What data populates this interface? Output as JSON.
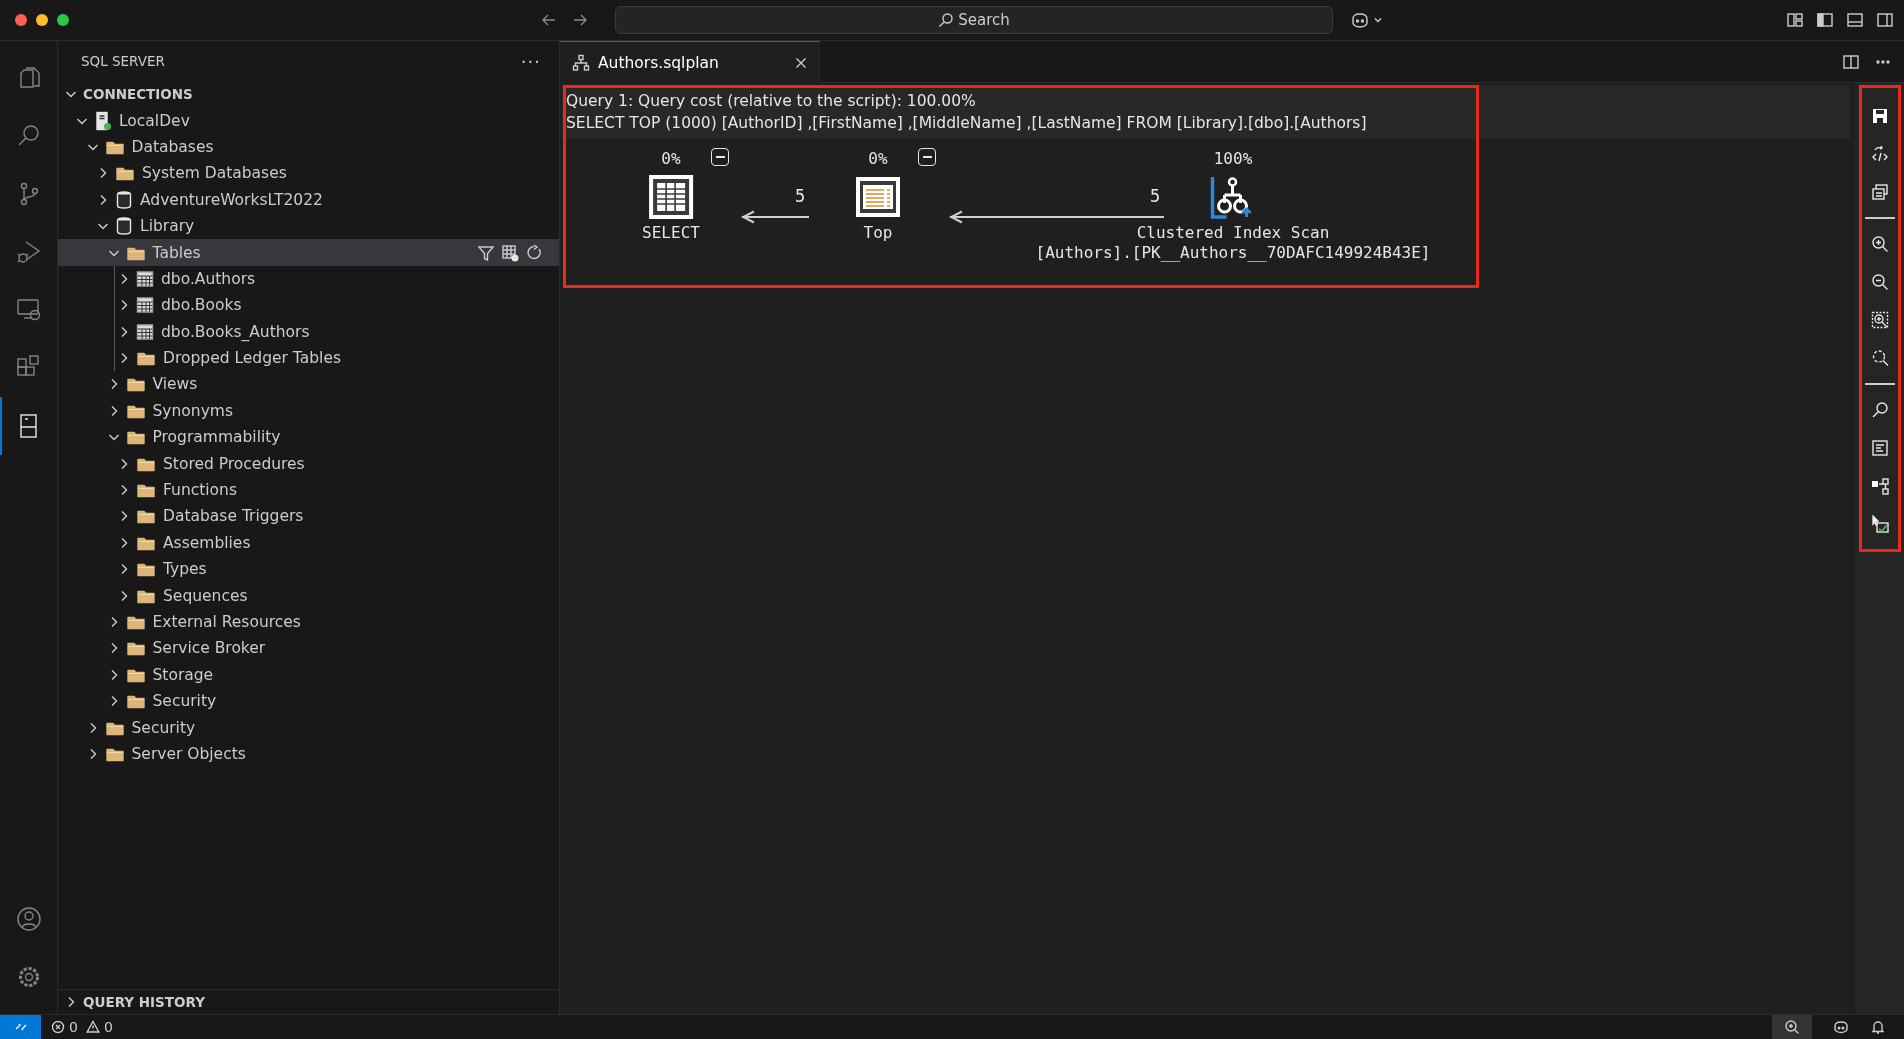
{
  "titlebar": {
    "search": {
      "placeholder": "Search"
    }
  },
  "activity_bar": {
    "top": [
      {
        "kind": "files",
        "selected": false
      },
      {
        "kind": "search",
        "selected": false
      },
      {
        "kind": "branch",
        "selected": false
      },
      {
        "kind": "debug",
        "selected": false
      },
      {
        "kind": "remote",
        "selected": false
      },
      {
        "kind": "extensions",
        "selected": false
      },
      {
        "kind": "server",
        "selected": true
      }
    ],
    "bottom": [
      {
        "kind": "account",
        "selected": false
      },
      {
        "kind": "settings",
        "selected": false
      }
    ]
  },
  "sidebar": {
    "title": "SQL SERVER",
    "more": "···",
    "connections": {
      "title": "CONNECTIONS",
      "expanded": true
    },
    "tree": [
      {
        "label": "LocalDev",
        "kind": "server",
        "connected": true,
        "expanded": true,
        "selected": false,
        "children": [
          {
            "label": "Databases",
            "kind": "folder",
            "expanded": true,
            "selected": false,
            "children": [
              {
                "label": "System Databases",
                "kind": "folder",
                "expanded": false,
                "selected": false
              },
              {
                "label": "AdventureWorksLT2022",
                "kind": "database",
                "expanded": false,
                "selected": false
              },
              {
                "label": "Library",
                "kind": "database",
                "expanded": true,
                "selected": false,
                "children": [
                  {
                    "label": "Tables",
                    "kind": "folder",
                    "expanded": true,
                    "selected": true,
                    "show_actions": true,
                    "children": [
                      {
                        "label": "dbo.Authors",
                        "kind": "table",
                        "expanded": false,
                        "selected": false
                      },
                      {
                        "label": "dbo.Books",
                        "kind": "table",
                        "expanded": false,
                        "selected": false
                      },
                      {
                        "label": "dbo.Books_Authors",
                        "kind": "table",
                        "expanded": false,
                        "selected": false
                      },
                      {
                        "label": "Dropped Ledger Tables",
                        "kind": "folder",
                        "expanded": false,
                        "selected": false
                      }
                    ]
                  },
                  {
                    "label": "Views",
                    "kind": "folder",
                    "expanded": false,
                    "selected": false
                  },
                  {
                    "label": "Synonyms",
                    "kind": "folder",
                    "expanded": false,
                    "selected": false
                  },
                  {
                    "label": "Programmability",
                    "kind": "folder",
                    "expanded": true,
                    "selected": false,
                    "children": [
                      {
                        "label": "Stored Procedures",
                        "kind": "folder",
                        "expanded": false,
                        "selected": false
                      },
                      {
                        "label": "Functions",
                        "kind": "folder",
                        "expanded": false,
                        "selected": false
                      },
                      {
                        "label": "Database Triggers",
                        "kind": "folder",
                        "expanded": false,
                        "selected": false
                      },
                      {
                        "label": "Assemblies",
                        "kind": "folder",
                        "expanded": false,
                        "selected": false
                      },
                      {
                        "label": "Types",
                        "kind": "folder",
                        "expanded": false,
                        "selected": false
                      },
                      {
                        "label": "Sequences",
                        "kind": "folder",
                        "expanded": false,
                        "selected": false
                      }
                    ]
                  },
                  {
                    "label": "External Resources",
                    "kind": "folder",
                    "expanded": false,
                    "selected": false
                  },
                  {
                    "label": "Service Broker",
                    "kind": "folder",
                    "expanded": false,
                    "selected": false
                  },
                  {
                    "label": "Storage",
                    "kind": "folder",
                    "expanded": false,
                    "selected": false
                  },
                  {
                    "label": "Security",
                    "kind": "folder",
                    "expanded": false,
                    "selected": false
                  }
                ]
              }
            ]
          },
          {
            "label": "Security",
            "kind": "folder",
            "expanded": false,
            "selected": false
          },
          {
            "label": "Server Objects",
            "kind": "folder",
            "expanded": false,
            "selected": false
          }
        ]
      }
    ],
    "query_history": {
      "title": "QUERY HISTORY",
      "expanded": false
    }
  },
  "tabs": [
    {
      "label": "Authors.sqlplan",
      "selected": true
    }
  ],
  "plan": {
    "header": [
      "Query 1: Query cost (relative to the script): 100.00%",
      "SELECT TOP (1000) [AuthorID] ,[FirstName] ,[MiddleName] ,[LastName] FROM [Library].[dbo].[Authors]"
    ],
    "nodes": [
      {
        "kind": "select",
        "cost": "0%",
        "label": "SELECT",
        "collapsible": true
      },
      {
        "kind": "top",
        "cost": "0%",
        "label": "Top",
        "collapsible": true
      },
      {
        "kind": "scan",
        "cost": "100%",
        "label": "Clustered Index Scan",
        "detail": "[Authors].[PK__Authors__70DAFC149924B43E]",
        "collapsible": false
      }
    ],
    "edges": [
      {
        "rows": "5"
      },
      {
        "rows": "5"
      }
    ]
  },
  "toolbar": [
    {
      "kind": "save"
    },
    {
      "kind": "xml"
    },
    {
      "kind": "open-query"
    },
    {
      "kind": "separator"
    },
    {
      "kind": "zoom-in"
    },
    {
      "kind": "zoom-out"
    },
    {
      "kind": "zoom-custom"
    },
    {
      "kind": "zoom-fit"
    },
    {
      "kind": "separator"
    },
    {
      "kind": "find"
    },
    {
      "kind": "properties"
    },
    {
      "kind": "compare"
    },
    {
      "kind": "highlight"
    }
  ],
  "status_bar": {
    "errors": "0",
    "warnings": "0"
  }
}
